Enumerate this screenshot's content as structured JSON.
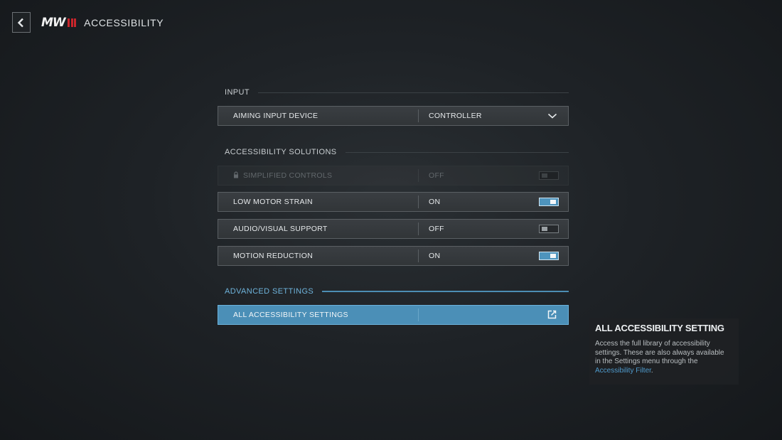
{
  "header": {
    "back_icon": "chevron-left-icon",
    "logo_text": "MW",
    "logo_mark_color": "#c8252b",
    "title": "ACCESSIBILITY"
  },
  "sections": {
    "input": {
      "label": "INPUT",
      "rows": [
        {
          "label": "AIMING INPUT DEVICE",
          "value": "CONTROLLER",
          "control": "dropdown"
        }
      ]
    },
    "solutions": {
      "label": "ACCESSIBILITY SOLUTIONS",
      "rows": [
        {
          "label": "SIMPLIFIED CONTROLS",
          "value": "OFF",
          "control": "toggle",
          "state": false,
          "locked": true
        },
        {
          "label": "LOW MOTOR STRAIN",
          "value": "ON",
          "control": "toggle",
          "state": true
        },
        {
          "label": "AUDIO/VISUAL SUPPORT",
          "value": "OFF",
          "control": "toggle",
          "state": false
        },
        {
          "label": "MOTION REDUCTION",
          "value": "ON",
          "control": "toggle",
          "state": true
        }
      ]
    },
    "advanced": {
      "label": "ADVANCED SETTINGS",
      "rows": [
        {
          "label": "ALL ACCESSIBILITY SETTINGS",
          "value": "",
          "control": "external-link",
          "selected": true
        }
      ]
    }
  },
  "tooltip": {
    "title": "ALL ACCESSIBILITY SETTING",
    "body": "Access the full library of accessibility settings. These are also always available in the Settings menu through the ",
    "link": "Accessibility Filter",
    "body_end": "."
  },
  "colors": {
    "accent": "#4b8fb7",
    "accent_text": "#6fb4dc",
    "link": "#4f9acb",
    "toggle_on": "#4e94bd"
  }
}
